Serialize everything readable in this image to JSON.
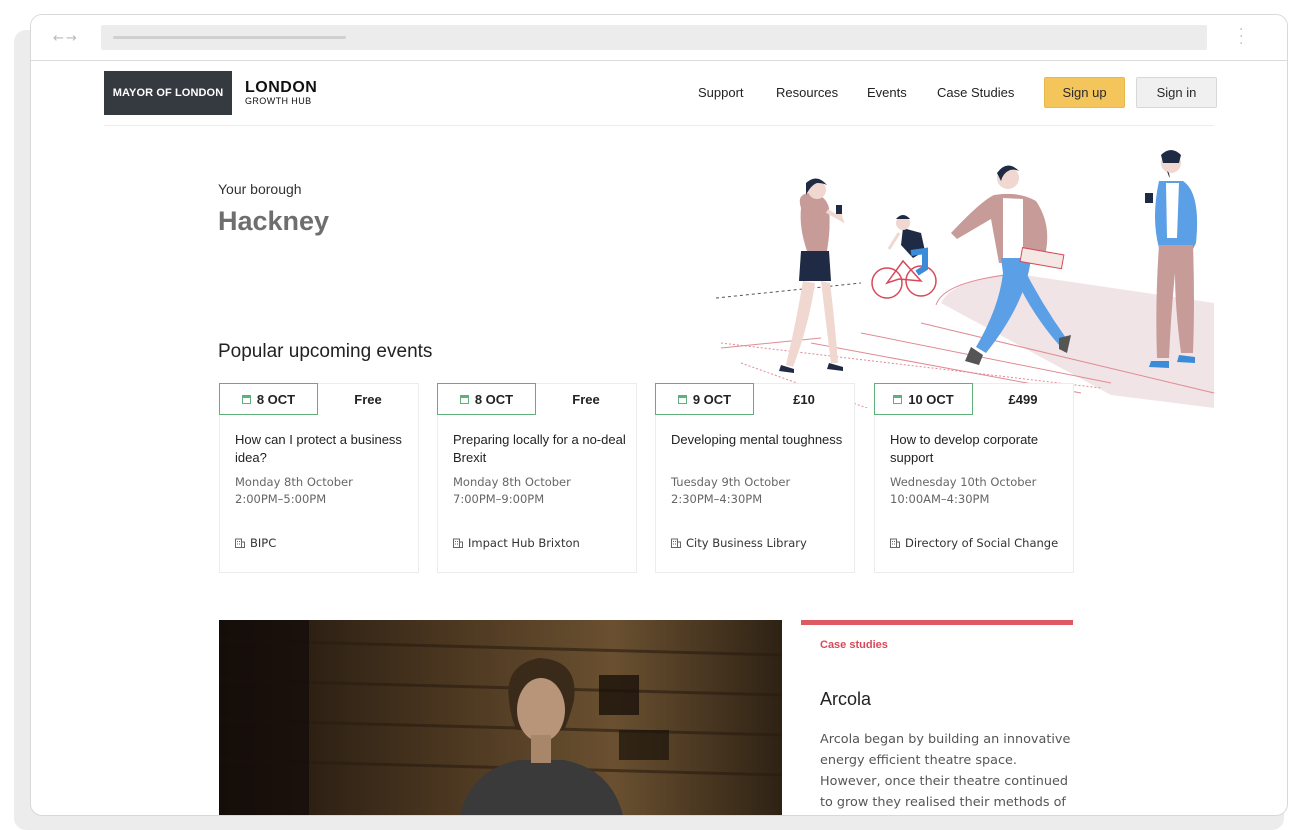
{
  "header": {
    "logo_mayor": "MAYOR OF LONDON",
    "logo_hub_line1": "LONDON",
    "logo_hub_line2": "GROWTH HUB",
    "nav": [
      "Support",
      "Resources",
      "Events",
      "Case Studies"
    ],
    "signup_label": "Sign up",
    "signin_label": "Sign in",
    "signup_color": "#f3c55a"
  },
  "borough": {
    "label": "Your borough",
    "name": "Hackney"
  },
  "events": {
    "heading": "Popular upcoming events",
    "items": [
      {
        "date": "8 OCT",
        "price": "Free",
        "title": "How can I protect a business idea?",
        "day": "Monday 8th October",
        "time": "2:00PM–5:00PM",
        "venue": "BIPC"
      },
      {
        "date": "8 OCT",
        "price": "Free",
        "title": "Preparing locally for a no-deal Brexit",
        "day": "Monday 8th October",
        "time": "7:00PM–9:00PM",
        "venue": "Impact Hub Brixton"
      },
      {
        "date": "9 OCT",
        "price": "£10",
        "title": "Developing mental toughness",
        "day": "Tuesday 9th October",
        "time": "2:30PM–4:30PM",
        "venue": "City Business Library"
      },
      {
        "date": "10 OCT",
        "price": "£499",
        "title": "How to develop corporate support",
        "day": "Wednesday 10th October",
        "time": "10:00AM–4:30PM",
        "venue": "Directory of Social Change"
      }
    ],
    "accent_color": "#5fb07a"
  },
  "case_study": {
    "label": "Case studies",
    "title": "Arcola",
    "text": "Arcola began by building an innovative energy efficient theatre space. However, once their theatre continued to grow they realised their methods of",
    "accent_color": "#dd5a63"
  }
}
